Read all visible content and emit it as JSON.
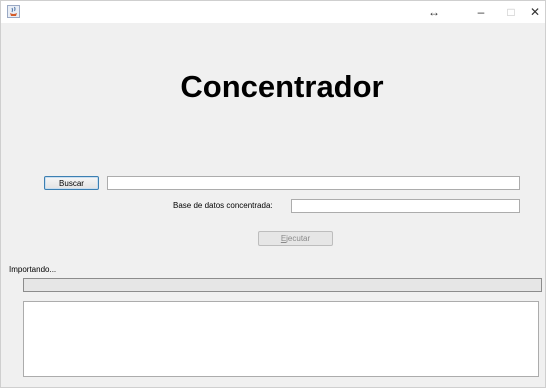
{
  "titlebar": {
    "icon": "java-cup-icon",
    "resize_glyph": "↔",
    "minimize_glyph": "–",
    "maximize_glyph": "□",
    "close_glyph": "✕"
  },
  "main": {
    "heading": "Concentrador",
    "buscar_label": "Buscar",
    "path_value": "",
    "db_label": "Base de datos concentrada:",
    "db_value": "",
    "ejecutar_label": "Ejecutar",
    "ejecutar_enabled": false,
    "status_label": "Importando...",
    "progress": 0,
    "log_text": ""
  },
  "colors": {
    "window_bg": "#f0f0f0",
    "focus_border": "#3c7fb1"
  }
}
